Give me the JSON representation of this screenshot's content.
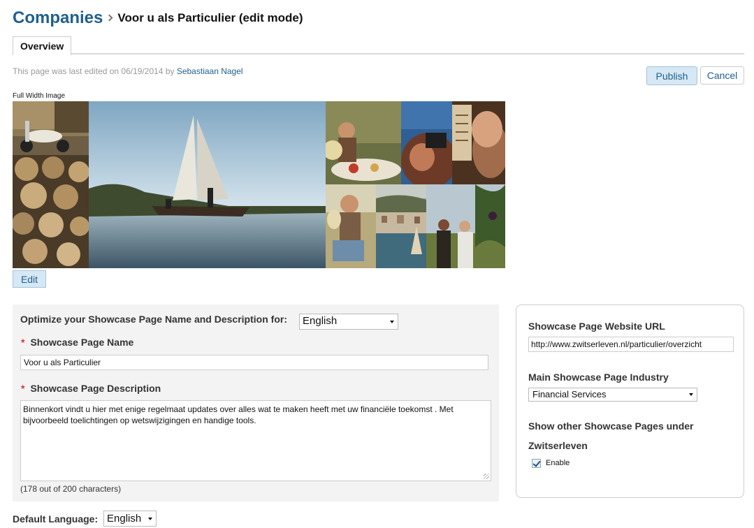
{
  "header": {
    "breadcrumb_root": "Companies",
    "page_title": "Voor u als Particulier (edit mode)"
  },
  "tabs": [
    {
      "label": "Overview"
    }
  ],
  "edit_info": {
    "prefix": "This page was last edited on 06/19/2014 by ",
    "user": "Sebastiaan Nagel"
  },
  "actions": {
    "publish_label": "Publish",
    "cancel_label": "Cancel"
  },
  "image": {
    "label": "Full Width Image",
    "edit_label": "Edit"
  },
  "form": {
    "optimize_label": "Optimize your Showcase Page Name and Description for:",
    "optimize_language": "English",
    "required_marker": "*",
    "name_label": "Showcase Page Name",
    "name_value": "Voor u als Particulier",
    "description_label": "Showcase Page Description",
    "description_value": "Binnenkort vindt u hier met enige regelmaat updates over alles wat te maken heeft met uw financiële toekomst . Met bijvoorbeeld toelichtingen op wetswijzigingen en handige tools.",
    "char_count": "(178 out of 200 characters)",
    "default_language_label": "Default Language:",
    "default_language_value": "English"
  },
  "sidebar": {
    "url_label": "Showcase Page Website URL",
    "url_value": "http://www.zwitserleven.nl/particulier/overzicht",
    "industry_label": "Main Showcase Page Industry",
    "industry_value": "Financial Services",
    "show_other_label_line1": "Show other Showcase Pages under",
    "show_other_label_line2": "Zwitserleven",
    "enable_label": "Enable",
    "enable_checked": true
  },
  "colors": {
    "brand_blue": "#1f5f8e",
    "button_fill": "#d6e8f4",
    "panel_gray": "#f3f3f3",
    "required_red": "#dd3333"
  }
}
